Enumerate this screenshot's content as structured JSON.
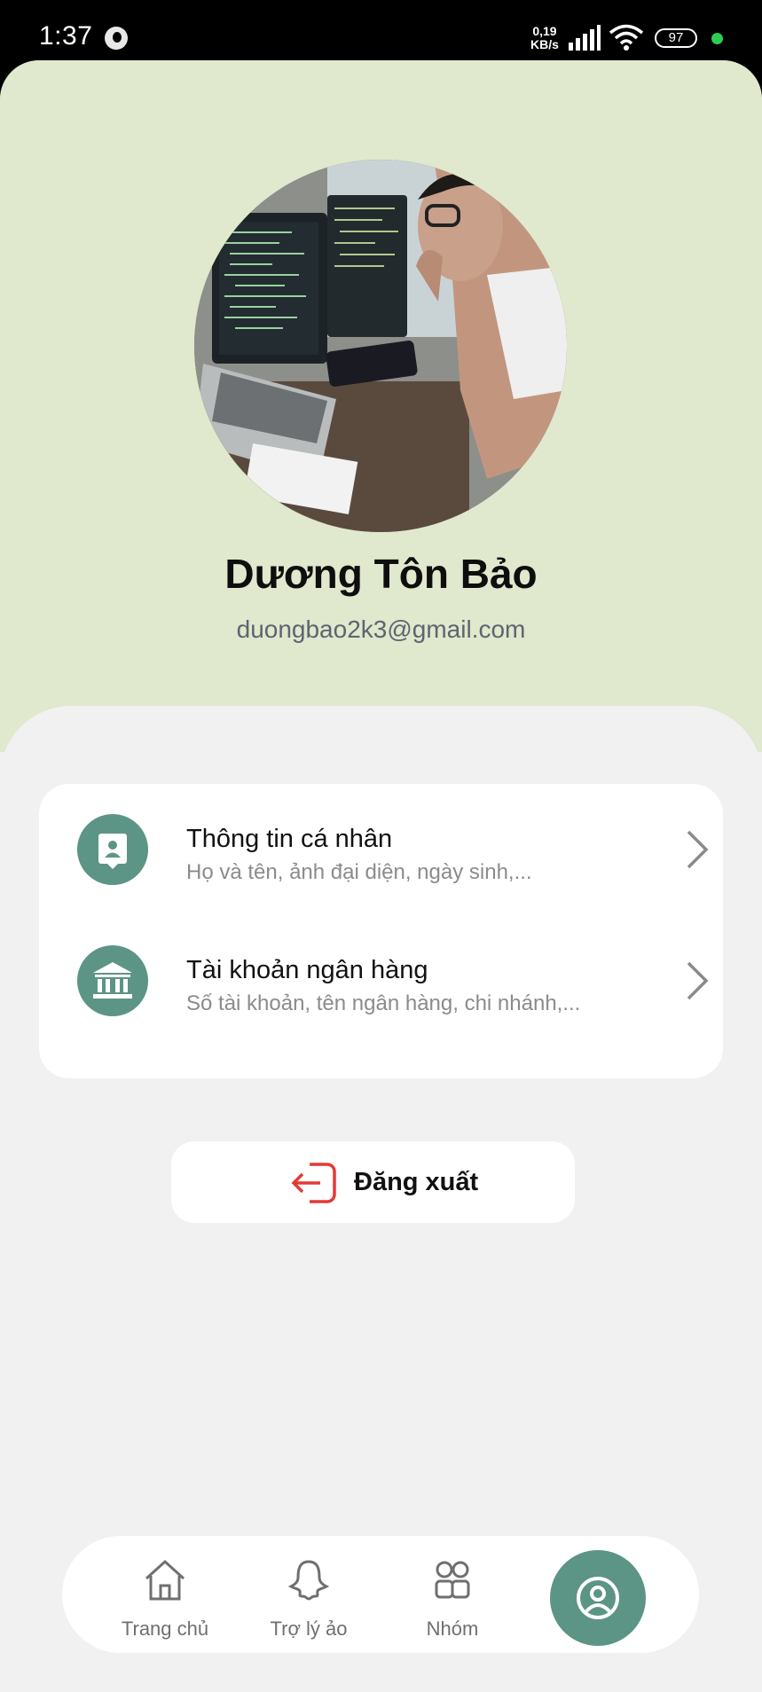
{
  "status_bar": {
    "time": "1:37",
    "net_speed_value": "0,19",
    "net_speed_unit": "KB/s",
    "battery": "97"
  },
  "profile": {
    "name": "Dương Tôn Bảo",
    "email": "duongbao2k3@gmail.com",
    "avatar_icon": "profile-photo"
  },
  "menu": {
    "items": [
      {
        "title": "Thông tin cá nhân",
        "subtitle": "Họ và tên, ảnh đại diện, ngày sinh,...",
        "icon": "id-badge-icon"
      },
      {
        "title": "Tài khoản ngân hàng",
        "subtitle": "Số tài khoản, tên ngân hàng, chi nhánh,...",
        "icon": "bank-icon"
      }
    ]
  },
  "logout": {
    "label": "Đăng xuất",
    "color": "#e53935"
  },
  "bottom_nav": {
    "items": [
      {
        "label": "Trang chủ",
        "icon": "home-icon"
      },
      {
        "label": "Trợ lý ảo",
        "icon": "ghost-assistant-icon"
      },
      {
        "label": "Nhóm",
        "icon": "group-icon"
      }
    ],
    "active_icon": "user-profile-icon"
  },
  "colors": {
    "accent": "#5c9485",
    "header_bg": "#e0e8cd",
    "page_bg": "#f1f1f1"
  }
}
